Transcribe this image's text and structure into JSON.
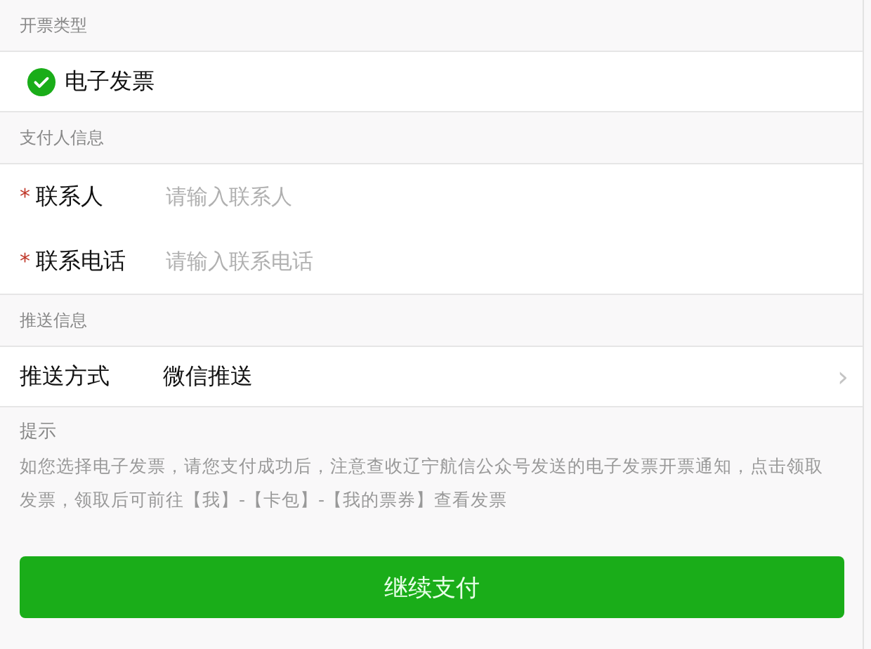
{
  "invoice_type": {
    "header": "开票类型",
    "options": [
      {
        "label": "电子发票",
        "selected": true
      }
    ]
  },
  "payer_info": {
    "header": "支付人信息",
    "fields": [
      {
        "label": "联系人",
        "placeholder": "请输入联系人",
        "required": true,
        "required_mark": "*"
      },
      {
        "label": "联系电话",
        "placeholder": "请输入联系电话",
        "required": true,
        "required_mark": "*"
      }
    ]
  },
  "push_info": {
    "header": "推送信息",
    "label": "推送方式",
    "value": "微信推送",
    "chevron": "›"
  },
  "tip": {
    "header": "提示",
    "text": "如您选择电子发票，请您支付成功后，注意查收辽宁航信公众号发送的电子发票开票通知，点击领取发票，领取后可前往【我】-【卡包】-【我的票券】查看发票"
  },
  "button": "继续支付"
}
